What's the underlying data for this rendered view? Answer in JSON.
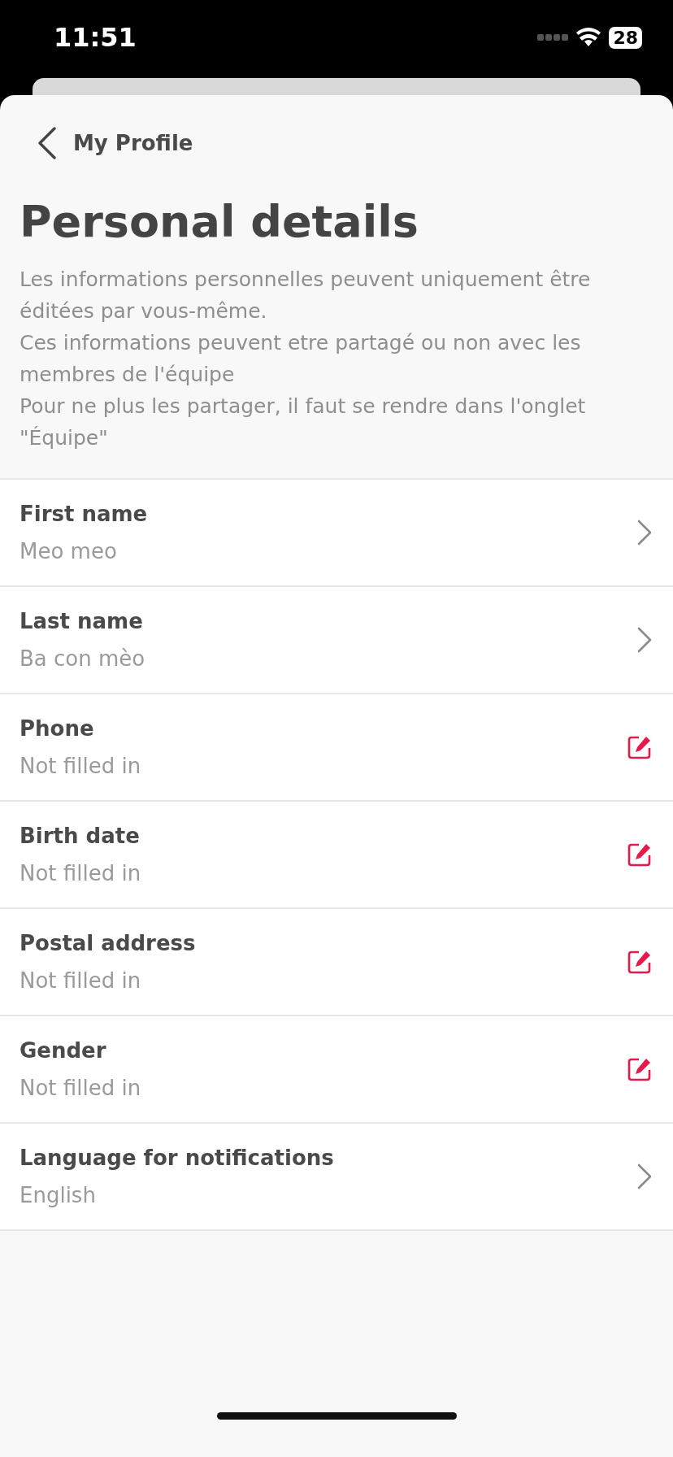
{
  "status_bar": {
    "time": "11:51",
    "battery": "28"
  },
  "header": {
    "back_label": "My Profile"
  },
  "title": "Personal details",
  "description": [
    "Les informations personnelles peuvent uniquement être éditées par vous-même.",
    "Ces informations peuvent etre partagé ou non avec les membres de l'équipe",
    "Pour ne plus les partager, il faut se rendre dans l'onglet \"Équipe\""
  ],
  "fields": [
    {
      "label": "First name",
      "value": "Meo meo",
      "kind": "chevron"
    },
    {
      "label": "Last name",
      "value": "Ba con mèo",
      "kind": "chevron"
    },
    {
      "label": "Phone",
      "value": "Not filled in",
      "kind": "edit"
    },
    {
      "label": "Birth date",
      "value": "Not filled in",
      "kind": "edit"
    },
    {
      "label": "Postal address",
      "value": "Not filled in",
      "kind": "edit"
    },
    {
      "label": "Gender",
      "value": "Not filled in",
      "kind": "edit"
    },
    {
      "label": "Language for notifications",
      "value": "English",
      "kind": "chevron"
    }
  ]
}
